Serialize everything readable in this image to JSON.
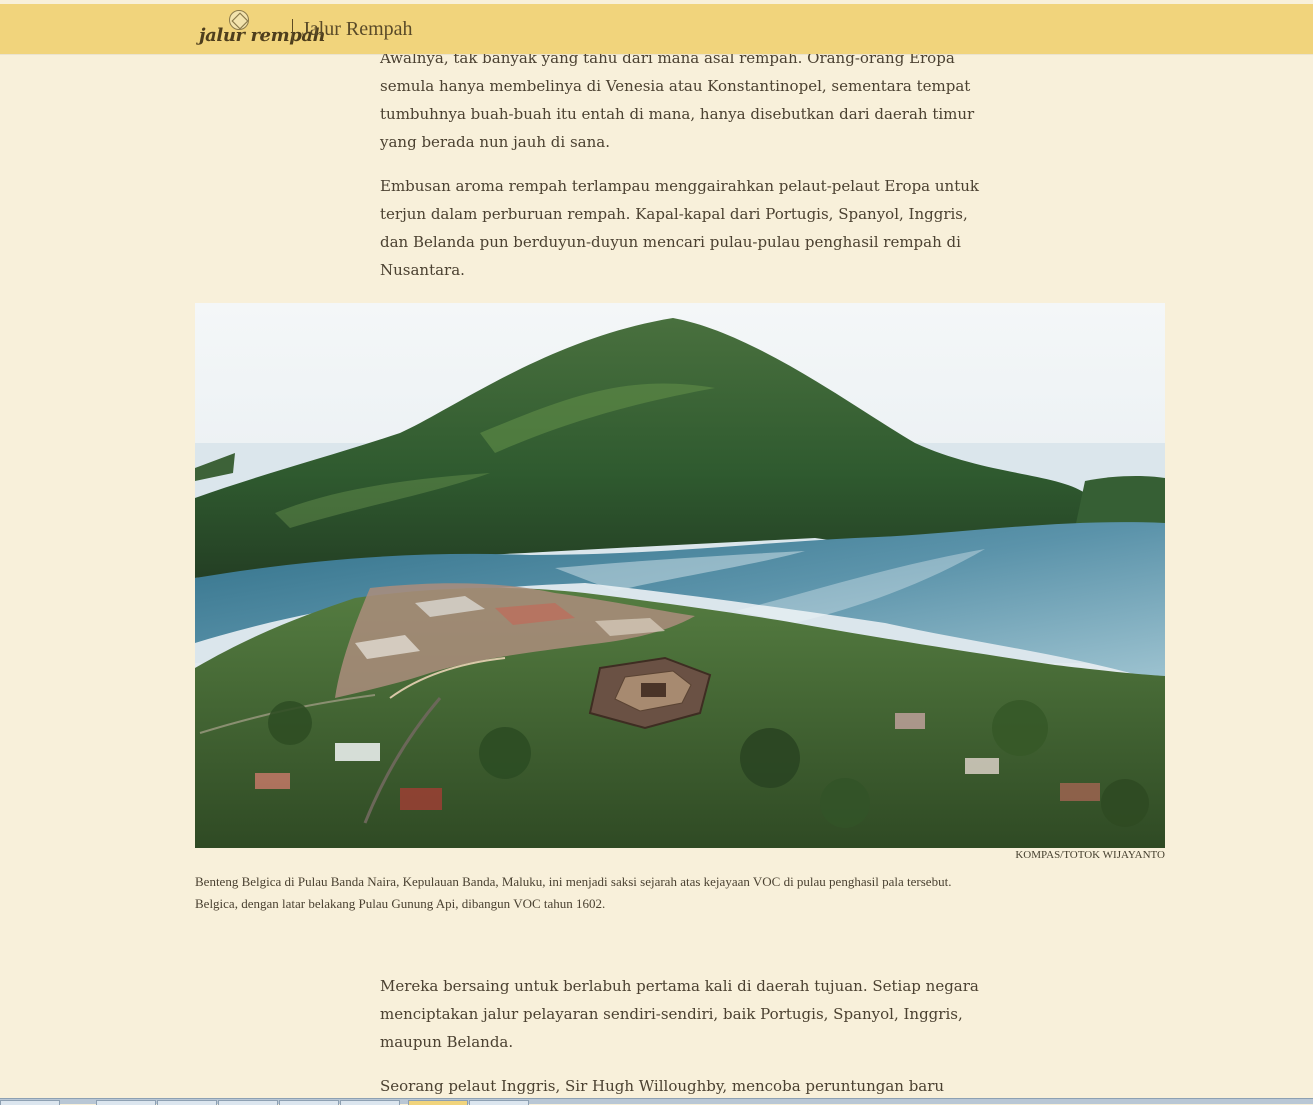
{
  "header": {
    "brand_text": "jalur rempah",
    "section_title": "Jalur Rempah"
  },
  "article": {
    "paragraphs": [
      "Awalnya, tak banyak yang tahu dari mana asal rempah. Orang-orang Eropa semula hanya membelinya di Venesia atau Konstantinopel, sementara tempat tumbuhnya buah-buah itu entah di mana, hanya disebutkan dari daerah timur yang berada nun jauh di sana.",
      "Embusan aroma rempah terlampau menggairahkan pelaut-pelaut Eropa untuk terjun dalam perburuan rempah. Kapal-kapal dari Portugis, Spanyol, Inggris, dan Belanda pun berduyun-duyun mencari pulau-pulau penghasil rempah di Nusantara.",
      "Mereka bersaing untuk berlabuh pertama kali di daerah tujuan. Setiap negara menciptakan jalur pelayaran sendiri-sendiri, baik Portugis, Spanyol, Inggris, maupun Belanda.",
      "Seorang pelaut Inggris, Sir Hugh Willoughby, mencoba peruntungan baru berlayar"
    ]
  },
  "figure": {
    "credit": "KOMPAS/TOTOK WIJAYANTO",
    "caption": "Benteng Belgica di Pulau Banda Naira, Kepulauan Banda, Maluku, ini menjadi saksi sejarah atas kejayaan VOC di pulau penghasil pala tersebut. Belgica, dengan latar belakang Pulau Gunung Api, dibangun VOC tahun 1602."
  },
  "colors": {
    "background": "#f8f0da",
    "header": "#f1d47c",
    "text": "#4b4131"
  }
}
